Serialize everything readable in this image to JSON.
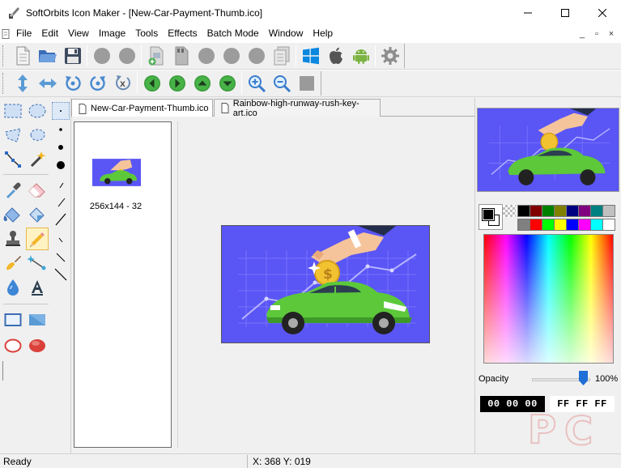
{
  "window": {
    "title": "SoftOrbits Icon Maker - [New-Car-Payment-Thumb.ico]",
    "app_icon": "paint-brush-icon",
    "controls": [
      "minimize-icon",
      "maximize-icon",
      "close-icon"
    ]
  },
  "menu": {
    "items": [
      "File",
      "Edit",
      "View",
      "Image",
      "Tools",
      "Effects",
      "Batch Mode",
      "Window",
      "Help"
    ],
    "mdi_controls": [
      "_",
      "▫",
      "×"
    ]
  },
  "toolbar1": {
    "buttons": [
      "new-file-icon",
      "open-folder-icon",
      "save-icon",
      "disabled-circle-icon",
      "disabled-circle-icon",
      "add-page-icon",
      "page-icon",
      "disabled-circle-icon",
      "disabled-circle-icon",
      "disabled-circle-icon",
      "pages-icon",
      "windows-logo-icon",
      "apple-logo-icon",
      "android-logo-icon",
      "gear-icon"
    ]
  },
  "toolbar2": {
    "buttons": [
      "flip-vertical-icon",
      "flip-horizontal-icon",
      "rotate-left-icon",
      "rotate-right-icon",
      "rotate-free-icon",
      "arrow-left-icon",
      "arrow-right-icon",
      "arrow-up-icon",
      "arrow-down-icon",
      "zoom-in-icon",
      "zoom-out-icon",
      "actual-size-icon"
    ]
  },
  "tabs": [
    {
      "label": "New-Car-Payment-Thumb.ico",
      "active": true
    },
    {
      "label": "Rainbow-high-runway-rush-key-art.ico",
      "active": false
    }
  ],
  "thumbnail": {
    "label": "256x144 - 32"
  },
  "colors": {
    "accent_blue": "#5a55f5",
    "car_green": "#5cc83a",
    "palette": [
      "#000000",
      "#800000",
      "#008000",
      "#808000",
      "#000080",
      "#800080",
      "#008080",
      "#c0c0c0",
      "#808080",
      "#ff0000",
      "#00ff00",
      "#ffff00",
      "#0000ff",
      "#ff00ff",
      "#00ffff",
      "#ffffff"
    ]
  },
  "panel": {
    "opacity_label": "Opacity",
    "opacity_value": "100%",
    "opacity_fraction": 1.0,
    "primary_hex": "00 00 00",
    "secondary_hex": "FF FF FF"
  },
  "status": {
    "state": "Ready",
    "coords": "X: 368 Y: 019"
  }
}
